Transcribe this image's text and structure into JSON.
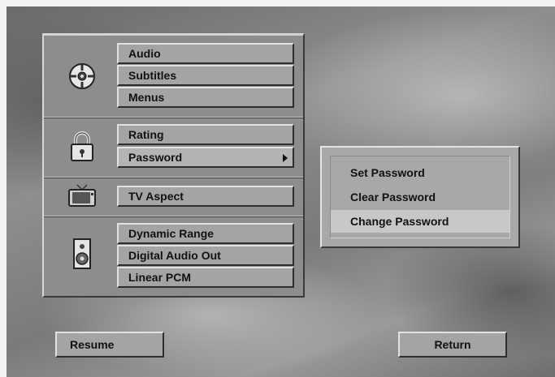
{
  "main_menu": {
    "groups": [
      {
        "icon": "disc-icon",
        "items": [
          "Audio",
          "Subtitles",
          "Menus"
        ]
      },
      {
        "icon": "lock-icon",
        "items": [
          "Rating",
          "Password"
        ]
      },
      {
        "icon": "tv-icon",
        "items": [
          "TV Aspect"
        ]
      },
      {
        "icon": "speaker-icon",
        "items": [
          "Dynamic Range",
          "Digital Audio Out",
          "Linear PCM"
        ]
      }
    ]
  },
  "password_submenu": {
    "items": [
      "Set Password",
      "Clear Password",
      "Change Password"
    ],
    "selected": "Change Password"
  },
  "footer": {
    "resume_label": "Resume",
    "return_label": "Return"
  }
}
